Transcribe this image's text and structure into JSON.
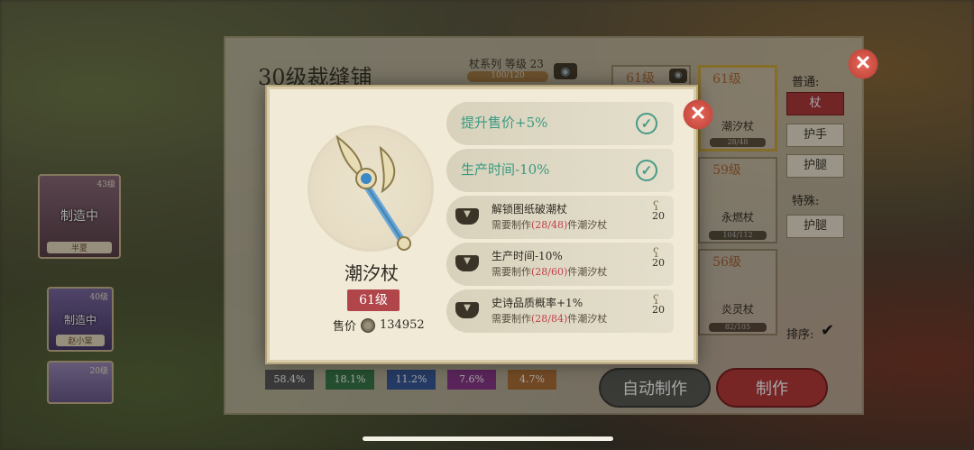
{
  "shop": {
    "title": "30级裁缝铺",
    "series_label": "杖系列 等级 23",
    "series_progress_text": "100/120",
    "series_progress": 0.83
  },
  "characters": [
    {
      "level": "43级",
      "status": "制造中",
      "name": "半夏"
    },
    {
      "level": "40级",
      "status": "制造中",
      "name": "赵小棠"
    },
    {
      "level": "20级",
      "status": "",
      "name": ""
    }
  ],
  "items": [
    {
      "level": "61级",
      "name": "",
      "progress": ""
    },
    {
      "level": "61级",
      "name": "潮汐杖",
      "progress": "28/48"
    },
    {
      "level": "59级",
      "name": "永燃杖",
      "progress": "104/112"
    },
    {
      "level": "56级",
      "name": "炎灵杖",
      "progress": "82/105"
    }
  ],
  "categories": {
    "normal_label": "普通:",
    "normal": [
      "杖",
      "护手",
      "护腿"
    ],
    "special_label": "特殊:",
    "special": [
      "护腿"
    ],
    "sort_label": "排序:"
  },
  "quality_rates": [
    {
      "value": "58.4%",
      "color": "#5a5a5a"
    },
    {
      "value": "18.1%",
      "color": "#3a7a4a"
    },
    {
      "value": "11.2%",
      "color": "#3a5a9a"
    },
    {
      "value": "7.6%",
      "color": "#8a3a8a"
    },
    {
      "value": "4.7%",
      "color": "#b0703a"
    }
  ],
  "buttons": {
    "auto_craft": "自动制作",
    "craft": "制作"
  },
  "modal": {
    "item_name": "潮汐杖",
    "level": "61级",
    "price_label": "售价",
    "price_value": "134952",
    "bonuses_unlocked": [
      {
        "text": "提升售价+5%"
      },
      {
        "text": "生产时间-10%"
      }
    ],
    "bonuses_locked": [
      {
        "title": "解锁图纸破潮杖",
        "req_prefix": "需要制作",
        "req_progress": "(28/48)",
        "req_suffix": "件潮汐杖",
        "cost": "20"
      },
      {
        "title": "生产时间-10%",
        "req_prefix": "需要制作",
        "req_progress": "(28/60)",
        "req_suffix": "件潮汐杖",
        "cost": "20"
      },
      {
        "title": "史诗品质概率+1%",
        "req_prefix": "需要制作",
        "req_progress": "(28/84)",
        "req_suffix": "件潮汐杖",
        "cost": "20"
      }
    ]
  }
}
